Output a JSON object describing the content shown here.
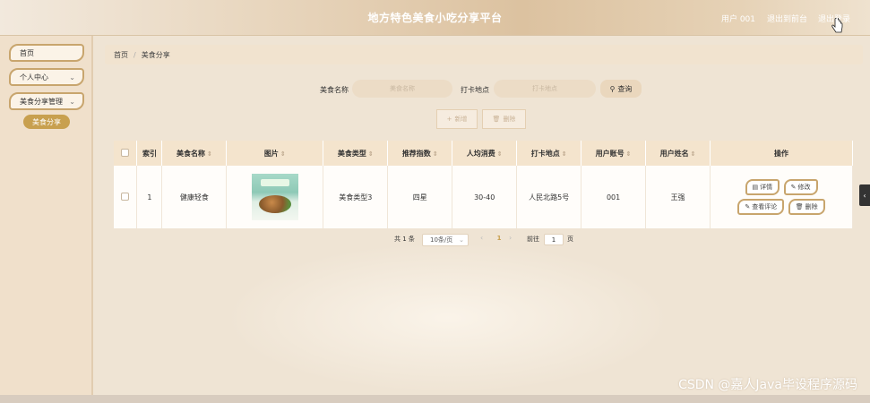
{
  "header": {
    "title": "地方特色美食小吃分享平台",
    "user": "用户 001",
    "back_link": "退出到前台",
    "logout_link": "退出登录"
  },
  "sidebar": {
    "items": [
      {
        "label": "首页",
        "icon": "none"
      },
      {
        "label": "个人中心",
        "icon": "chevron-down-icon"
      },
      {
        "label": "美食分享管理",
        "icon": "chevron-down-icon"
      }
    ],
    "sub_item": "美食分享"
  },
  "breadcrumb": {
    "home": "首页",
    "sep": "/",
    "current": "美食分享"
  },
  "search": {
    "name_label": "美食名称",
    "name_placeholder": "美食名称",
    "place_label": "打卡地点",
    "place_placeholder": "打卡地点",
    "query_button": "查询"
  },
  "actions": {
    "add": "新增",
    "delete": "删除"
  },
  "table": {
    "headers": {
      "index": "索引",
      "name": "美食名称",
      "image": "图片",
      "type": "美食类型",
      "rating": "推荐指数",
      "cost": "人均消费",
      "place": "打卡地点",
      "account": "用户账号",
      "username": "用户姓名",
      "ops": "操作"
    },
    "rows": [
      {
        "index": "1",
        "name": "健康轻食",
        "type": "美食类型3",
        "rating": "四星",
        "cost": "30-40",
        "place": "人民北路5号",
        "account": "001",
        "username": "王强"
      }
    ],
    "ops": {
      "detail": "详情",
      "edit": "修改",
      "comments": "查看评论",
      "delete": "删除"
    }
  },
  "pagination": {
    "total": "共 1 条",
    "page_size": "10条/页",
    "current_page": "1",
    "goto_label": "前往",
    "goto_value": "1",
    "page_suffix": "页"
  },
  "watermark": "CSDN @嘉人Java毕设程序源码",
  "colors": {
    "accent": "#c8a56d",
    "header_bg": "#dcc2a0",
    "sidebar_bg": "#f0e0cb"
  }
}
